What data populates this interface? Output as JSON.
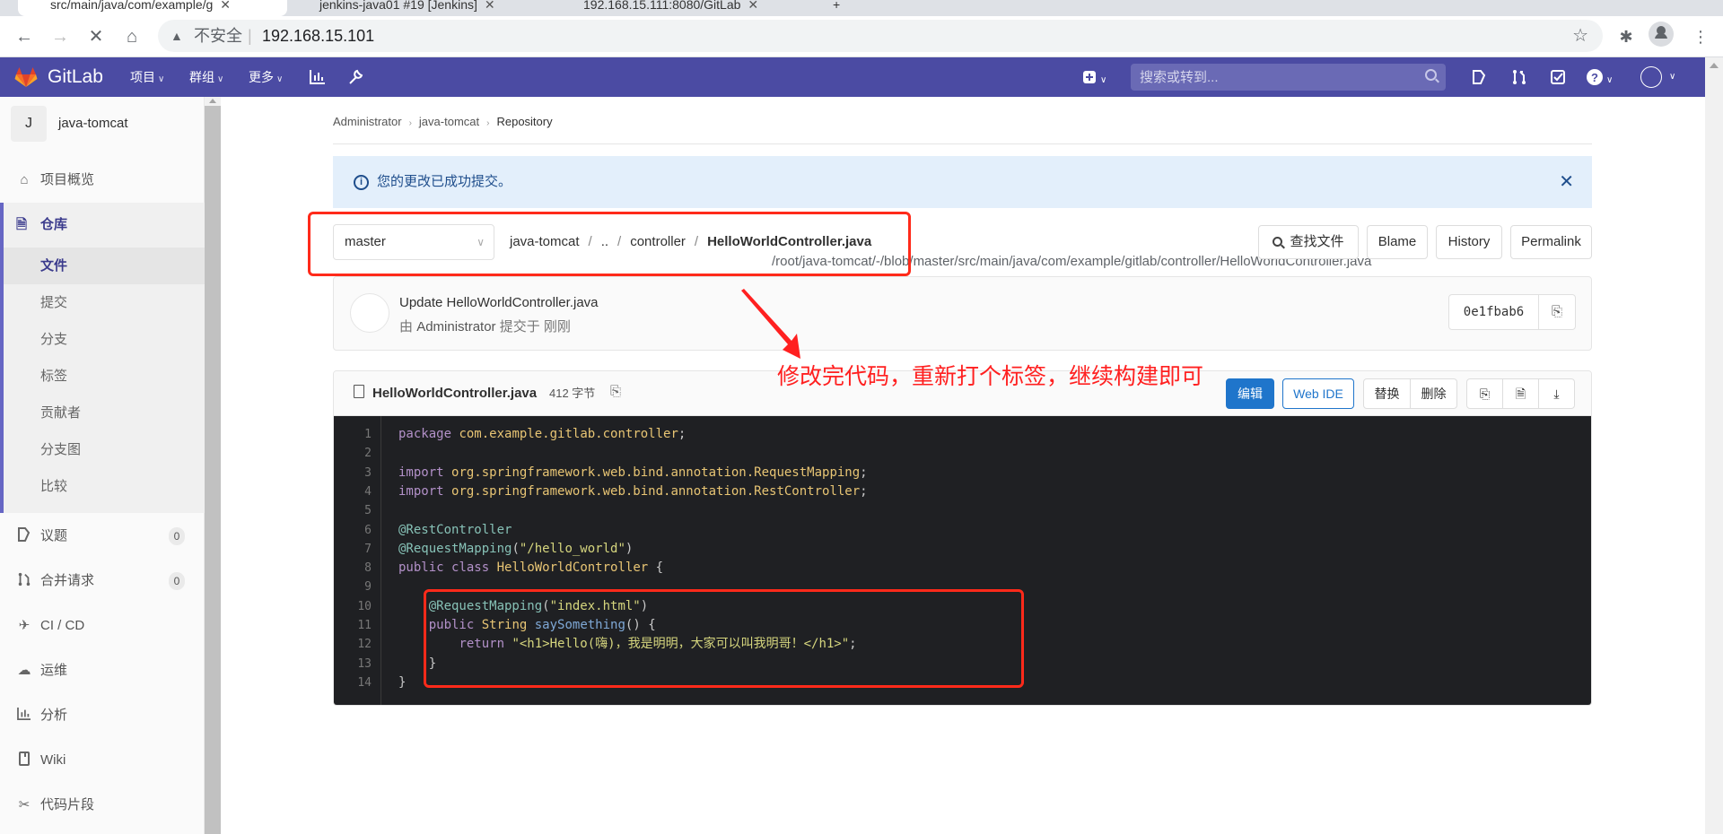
{
  "browser": {
    "tabs": [
      {
        "title": "src/main/java/com/example/g",
        "active": true
      },
      {
        "title": "jenkins-java01 #19 [Jenkins]",
        "active": false
      },
      {
        "title": "192.168.15.111:8080/GitLab",
        "active": false
      }
    ],
    "address": {
      "security_label": "不安全",
      "host": "192.168.15.101",
      "path": "/root/java-tomcat/-/blob/master/src/main/java/com/example/gitlab/controller/HelloWorldController.java"
    }
  },
  "gitlab_nav": {
    "brand": "GitLab",
    "menus": [
      {
        "label": "项目"
      },
      {
        "label": "群组"
      },
      {
        "label": "更多"
      }
    ],
    "search_placeholder": "搜索或转到...",
    "accent_color": "#4b4ba3"
  },
  "sidebar": {
    "project_initial": "J",
    "project_name": "java-tomcat",
    "overview": {
      "label": "项目概览",
      "icon": "home-icon"
    },
    "repository": {
      "label": "仓库",
      "icon": "document-icon",
      "items": [
        {
          "label": "文件",
          "active": true
        },
        {
          "label": "提交"
        },
        {
          "label": "分支"
        },
        {
          "label": "标签"
        },
        {
          "label": "贡献者"
        },
        {
          "label": "分支图"
        },
        {
          "label": "比较"
        }
      ]
    },
    "items": [
      {
        "label": "议题",
        "icon": "issues-icon",
        "badge": "0"
      },
      {
        "label": "合并请求",
        "icon": "merge-request-icon",
        "badge": "0"
      },
      {
        "label": "CI / CD",
        "icon": "rocket-icon"
      },
      {
        "label": "运维",
        "icon": "cloud-gear-icon"
      },
      {
        "label": "分析",
        "icon": "chart-icon"
      },
      {
        "label": "Wiki",
        "icon": "book-icon"
      },
      {
        "label": "代码片段",
        "icon": "scissors-icon"
      }
    ]
  },
  "breadcrumb": {
    "items": [
      "Administrator",
      "java-tomcat"
    ],
    "current": "Repository"
  },
  "flash": {
    "message": "您的更改已成功提交。"
  },
  "file_nav": {
    "branch": "master",
    "path": [
      "java-tomcat",
      "..",
      "controller"
    ],
    "file": "HelloWorldController.java",
    "buttons": {
      "find_file": "查找文件",
      "blame": "Blame",
      "history": "History",
      "permalink": "Permalink"
    }
  },
  "commit": {
    "title": "Update HelloWorldController.java",
    "by_prefix": "由",
    "author": "Administrator",
    "committed": "提交于",
    "time": "刚刚",
    "sha": "0e1fbab6"
  },
  "file": {
    "name": "HelloWorldController.java",
    "size": "412 字节",
    "buttons": {
      "edit": "编辑",
      "web_ide": "Web IDE",
      "replace": "替换",
      "delete": "删除"
    },
    "lines": [
      "package com.example.gitlab.controller;",
      "",
      "import org.springframework.web.bind.annotation.RequestMapping;",
      "import org.springframework.web.bind.annotation.RestController;",
      "",
      "@RestController",
      "@RequestMapping(\"/hello_world\")",
      "public class HelloWorldController {",
      "",
      "    @RequestMapping(\"index.html\")",
      "    public String saySomething() {",
      "        return \"<h1>Hello(嗨)，我是明明，大家可以叫我明哥！</h1>\";",
      "    }",
      "}"
    ]
  },
  "annotation": {
    "text": "修改完代码，重新打个标签，继续构建即可",
    "color": "#ff2020"
  }
}
